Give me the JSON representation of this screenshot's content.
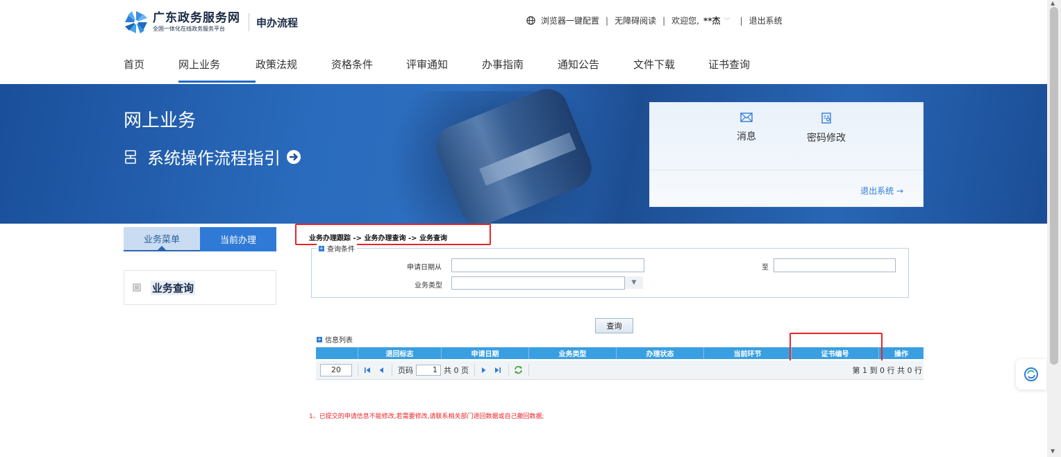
{
  "header": {
    "logo_title": "广东政务服务网",
    "logo_subtitle": "全国一体化在线政务服务平台",
    "section_title": "申办流程",
    "links": {
      "browser_config": "浏览器一键配置",
      "accessible_read": "无障碍阅读",
      "welcome": "欢迎您,",
      "user_name": "**杰",
      "logout": "退出系统"
    }
  },
  "nav": [
    "首页",
    "网上业务",
    "政策法规",
    "资格条件",
    "评审通知",
    "办事指南",
    "通知公告",
    "文件下载",
    "证书查询"
  ],
  "banner": {
    "title": "网上业务",
    "guide": "系统操作流程指引",
    "panel": {
      "message": "消息",
      "password": "密码修改",
      "logout": "退出系统 →"
    }
  },
  "sidebar": {
    "tab_menu": "业务菜单",
    "tab_current": "当前办理",
    "item": "业务查询"
  },
  "main": {
    "breadcrumb": "业务办理跟踪 -> 业务办理查询 -> 业务查询",
    "query_legend": "查询条件",
    "date_from_label": "申请日期从",
    "date_to_label": "至",
    "type_label": "业务类型",
    "query_button": "查询",
    "list_title": "信息列表",
    "columns": [
      "",
      "退回标志",
      "申请日期",
      "业务类型",
      "办理状态",
      "当前环节",
      "证书编号",
      "操作"
    ],
    "pager": {
      "page_size": "20",
      "page_label": "页码",
      "page_value": "1",
      "total_pages": "共 0 页",
      "info": "第 1 到 0 行 共 0 行"
    },
    "note": "1、已提交的申请信息不能修改,若需要修改,请联系相关部门退回数据或自己撤回数据;"
  },
  "colors": {
    "primary": "#2f7ad6",
    "grid_header": "#3a9fe1",
    "highlight_box": "#e8242a",
    "nav_underline": "#1f69c6"
  }
}
